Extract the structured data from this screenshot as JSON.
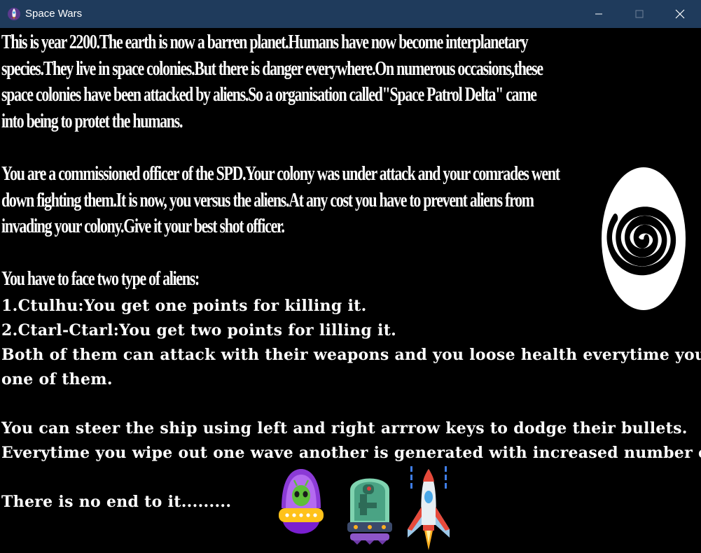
{
  "window": {
    "title": "Space Wars",
    "controls": {
      "minimize_icon": "minimize-icon",
      "maximize_icon": "maximize-icon",
      "close_icon": "close-icon"
    },
    "titlebar_color": "#1f3b5c"
  },
  "story": {
    "paragraph1": [
      "This is year 2200.The earth is now a barren planet.Humans have now become interplanetary",
      "species.They live in space colonies.But there is danger everywhere.On numerous occasions,these",
      "space colonies have been attacked by aliens.So a organisation called\"Space Patrol Delta\" came",
      "into being to protet the humans."
    ],
    "paragraph2": [
      "You are a commissioned officer of the SPD.Your colony was under attack and your comrades went",
      "down fighting them.It is now, you versus the aliens.At any cost you have to prevent aliens from",
      "invading your colony.Give it your best shot officer."
    ],
    "paragraph3_heading": "You have to face two type of aliens:"
  },
  "instructions": {
    "alien1": "1.Ctulhu:You get one points for killing it.",
    "alien2": "2.Ctarl-Ctarl:You get two points for lilling it.",
    "attack_line1": "Both of them can attack with their weapons and you loose health everytime you get hit by any",
    "attack_line2": "one of them.",
    "steer": "You can steer the ship using left and right arrrow keys to dodge their bullets.",
    "waves": "Everytime you wipe out one wave another is generated with increased number of enemies.",
    "ending": "There is no end to it........."
  },
  "images": {
    "spiral": "spiral-icon",
    "alien_ufo": "alien-ufo-sprite",
    "alien_robot": "alien-robot-sprite",
    "player_ship": "player-rocket-sprite"
  }
}
